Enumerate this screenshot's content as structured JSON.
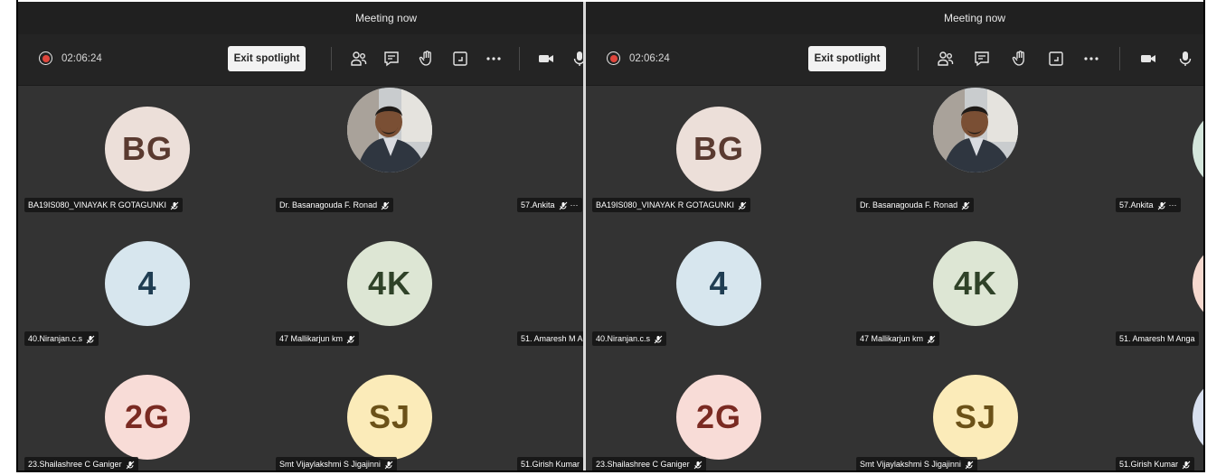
{
  "window": {
    "title": "Meeting now"
  },
  "toolbar": {
    "recording_timer": "02:06:24",
    "exit_spotlight_label": "Exit spotlight",
    "recording_color": "#e0463c"
  },
  "participants": [
    {
      "name": "BA19IS080_VINAYAK R GOTAGUNKI",
      "initials": "BG",
      "avatar_bg": "#ecdfd9",
      "initials_color": "#5a3a30",
      "muted": true
    },
    {
      "name": "Dr. Basanagouda F. Ronad",
      "initials": "",
      "avatar_bg": "photo",
      "initials_color": "",
      "muted": true
    },
    {
      "name": "57.Ankita",
      "initials": "",
      "avatar_bg": "#d4e6dc",
      "initials_color": "#2c4a38",
      "muted": true
    },
    {
      "name": "40.Niranjan.c.s",
      "initials": "4",
      "avatar_bg": "#d7e6ee",
      "initials_color": "#1f3d52",
      "muted": true
    },
    {
      "name": "47 Mallikarjun km",
      "initials": "4K",
      "avatar_bg": "#dde6d4",
      "initials_color": "#2f4228",
      "muted": true
    },
    {
      "name": "51. Amaresh M Anga",
      "initials": "",
      "avatar_bg": "#f6d9cf",
      "initials_color": "#6a2b20",
      "muted": true
    },
    {
      "name": "23.Shailashree C Ganiger",
      "initials": "2G",
      "avatar_bg": "#f8dcd7",
      "initials_color": "#7a2a22",
      "muted": true
    },
    {
      "name": "Smt Vijaylakshmi S Jigajinni",
      "initials": "SJ",
      "avatar_bg": "#fbebb9",
      "initials_color": "#6b5118",
      "muted": true
    },
    {
      "name": "51.Girish Kumar",
      "initials": "",
      "avatar_bg": "#d8e0ef",
      "initials_color": "#2d3b5a",
      "muted": true
    }
  ],
  "icons": [
    "record-icon",
    "participants-icon",
    "chat-icon",
    "raise-hand-icon",
    "share-tray-icon",
    "more-icon",
    "camera-icon",
    "microphone-icon",
    "mic-off-icon"
  ]
}
